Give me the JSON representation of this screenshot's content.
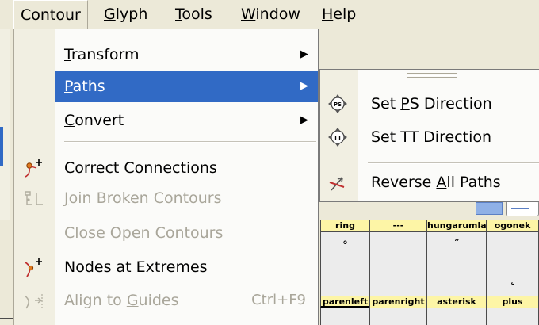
{
  "menubar": {
    "items": [
      {
        "label": "Contour",
        "mnemonic": "",
        "rest": "Contour"
      },
      {
        "label": "Glyph",
        "mnemonic": "G",
        "rest": "lyph"
      },
      {
        "label": "Tools",
        "mnemonic": "T",
        "rest": "ools"
      },
      {
        "label": "Window",
        "mnemonic": "W",
        "rest": "indow"
      },
      {
        "label": "Help",
        "mnemonic": "H",
        "rest": "elp"
      }
    ]
  },
  "contour_menu": {
    "transform": {
      "pre": "",
      "mn": "T",
      "post": "ransform"
    },
    "paths": {
      "pre": "",
      "mn": "P",
      "post": "aths"
    },
    "convert": {
      "pre": "",
      "mn": "C",
      "post": "onvert"
    },
    "correct_connections": {
      "pre": "Correct Co",
      "mn": "n",
      "post": "nections"
    },
    "join_broken_contours": {
      "pre": "",
      "mn": "J",
      "post": "oin Broken Contours"
    },
    "close_open_contours": {
      "pre": "Close Open Conto",
      "mn": "u",
      "post": "rs"
    },
    "nodes_at_extremes": {
      "pre": "Nodes at E",
      "mn": "x",
      "post": "tremes"
    },
    "align_to_guides": {
      "pre": "Align to ",
      "mn": "G",
      "post": "uides",
      "shortcut": "Ctrl+F9"
    },
    "submenu_arrow": "▶"
  },
  "paths_submenu": {
    "set_ps_direction": {
      "pre": "Set ",
      "mn": "P",
      "post": "S Direction"
    },
    "set_tt_direction": {
      "pre": "Set ",
      "mn": "T",
      "post": "T Direction"
    },
    "reverse_all_paths": {
      "pre": "Reverse ",
      "mn": "A",
      "post": "ll Paths"
    }
  },
  "glyph_grid": {
    "row1": [
      {
        "name": "ring",
        "glyph": "˚"
      },
      {
        "name": "---",
        "glyph": ""
      },
      {
        "name": "hungarumlaut",
        "glyph": "˝"
      },
      {
        "name": "ogonek",
        "glyph": "˛"
      }
    ],
    "row2": [
      {
        "name": "parenleft"
      },
      {
        "name": "parenright"
      },
      {
        "name": "asterisk"
      },
      {
        "name": "plus"
      }
    ]
  },
  "icons": {
    "correct_connections": "node-plus-icon",
    "join_broken_contours": "join-contours-icon",
    "nodes_at_extremes": "extreme-node-icon",
    "align_to_guides": "align-guides-icon",
    "set_ps_direction": "ps-direction-icon",
    "set_tt_direction": "tt-direction-icon",
    "reverse_all_paths": "reverse-paths-icon"
  },
  "colors": {
    "highlight": "#316ac5",
    "menu_bg": "#fbfbf9",
    "disabled_text": "#a9a69a",
    "glyph_header": "#fdf5a6"
  }
}
